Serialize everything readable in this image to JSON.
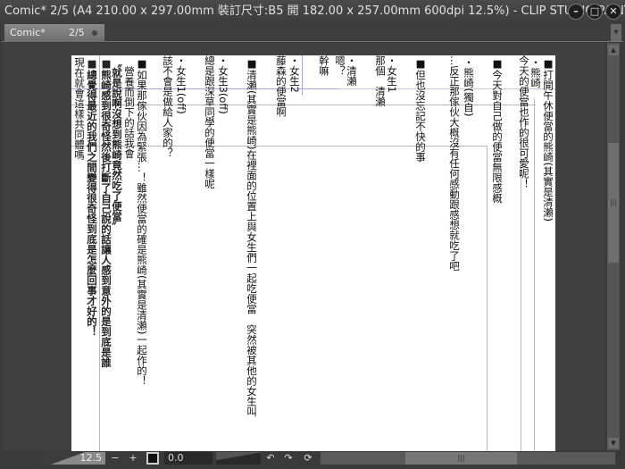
{
  "window": {
    "title": "Comic* 2/5 (A4 210.00 x 297.00mm 裝訂尺寸:B5 開 182.00 x 257.00mm 600dpi 12.5%)  - CLIP STUDIO PAINT",
    "minimize": "–",
    "maximize": "□",
    "close": "✕"
  },
  "tab": {
    "name": "Comic*",
    "page": "2/5"
  },
  "columns": [
    "■打開午休便當的熊崎(其實是清瀨)",
    "・熊崎",
    "今天的便當也作的很可愛呢！",
    "■今天對自己做的便當無限感概",
    "・熊崎(獨自)",
    "…反正那傢伙大概沒有任何感動跟感想就吃了吧",
    "■但也沒忘記不快的事",
    "・女生1",
    "那個　清瀨",
    "・清瀨",
    "嗯？",
    "幹嘛",
    "・女生2",
    "藤森的便當啊",
    "■清瀨(其實是熊崎)在裡面的位置上與女生們一起吃便當　突然被其他的女生叫",
    "・女生3(off)",
    "總是跟深草同學的便當一樣呢",
    "・女生1(off)",
    "該不會是做給人家的？",
    "■如果那傢伙因為緊張…！雖然便當的確是熊崎(其實是清瀨)一起作的！",
    "營養而倒下的話我會",
    "〝就是說啊沒想到熊崎竟然吃了便當〞",
    "■熊崎感到很奇怪然後打斷了自己說的話讓人感到意外的是到底是誰",
    "■總覺得最近的我們之間變得很奇怪到底是怎麼回事才好的！",
    "現在就會這樣共同體嗎"
  ],
  "status": {
    "zoom": "12.5",
    "angle": "0.0",
    "zoom_out": "−",
    "zoom_in": "+",
    "rotate_left": "↶",
    "rotate_right": "↷",
    "reset": "⟳",
    "thumb_grip": "|||"
  }
}
